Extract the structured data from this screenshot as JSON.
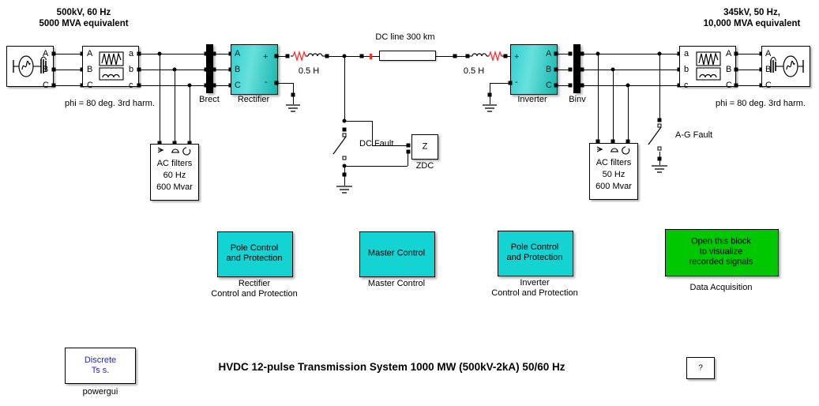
{
  "title": "HVDC 12-pulse Transmission System 1000 MW (500kV-2kA)   50/60 Hz",
  "annotations": {
    "left_source_header": "500kV, 60 Hz\n5000 MVA equivalent",
    "left_source_header_l1": "500kV, 60 Hz",
    "left_source_header_l2": "5000 MVA equivalent",
    "right_source_header_l1": "345kV, 50 Hz,",
    "right_source_header_l2": "10,000 MVA equivalent",
    "left_phi": "phi = 80 deg.  3rd harm.",
    "right_phi": "phi = 80 deg.  3rd harm.",
    "dc_line": "DC line 300 km",
    "reactor_left": "0.5 H",
    "reactor_right": "0.5 H",
    "dc_fault": "DC Fault",
    "ag_fault": "A-G Fault"
  },
  "blocks": {
    "brect": {
      "label": "Brect"
    },
    "binv": {
      "label": "Binv"
    },
    "rectifier": {
      "label": "Rectifier",
      "ports_left": [
        "A",
        "B",
        "C"
      ],
      "port_plus": "+",
      "port_minus": "-"
    },
    "inverter": {
      "label": "Inverter",
      "ports_right": [
        "A",
        "B",
        "C"
      ],
      "port_plus": "+",
      "port_minus": "-"
    },
    "src_left": {
      "ports": [
        "A",
        "B",
        "C"
      ]
    },
    "src_right": {
      "ports": [
        "A",
        "B",
        "C"
      ]
    },
    "filt_left": {
      "ports_left": [
        "A",
        "B",
        "C"
      ],
      "ports_right": [
        "a",
        "b",
        "c"
      ]
    },
    "filt_right": {
      "ports_left": [
        "a",
        "b",
        "c"
      ],
      "ports_right": [
        "A",
        "B",
        "C"
      ]
    },
    "acfilter_left": {
      "l1": "AC filters",
      "l2": "60 Hz",
      "l3": "600 Mvar"
    },
    "acfilter_right": {
      "l1": "AC filters",
      "l2": "50 Hz",
      "l3": "600 Mvar"
    },
    "zdc": {
      "text": "Z",
      "label": "ZDC"
    },
    "rect_control": {
      "text_l1": "Pole Control",
      "text_l2": "and Protection",
      "label_l1": "Rectifier",
      "label_l2": "Control and Protection"
    },
    "master_control": {
      "text": "Master Control",
      "label": "Master Control"
    },
    "inv_control": {
      "text_l1": "Pole Control",
      "text_l2": "and Protection",
      "label_l1": "Inverter",
      "label_l2": "Control and Protection"
    },
    "data_acq": {
      "text_l1": "Open this block",
      "text_l2": "to visualize",
      "text_l3": "recorded signals",
      "label": "Data Acquisition"
    },
    "powergui": {
      "text_l1": "Discrete",
      "text_l2": "Ts s.",
      "label": "powergui"
    },
    "help": {
      "text": "?"
    }
  },
  "colors": {
    "block_cyan": "#14d3d3",
    "block_green": "#00c800",
    "powergui_text": "#2222dd",
    "resistor_red": "#ff2a2a",
    "wire": "#000000",
    "background": "#ffffff"
  }
}
